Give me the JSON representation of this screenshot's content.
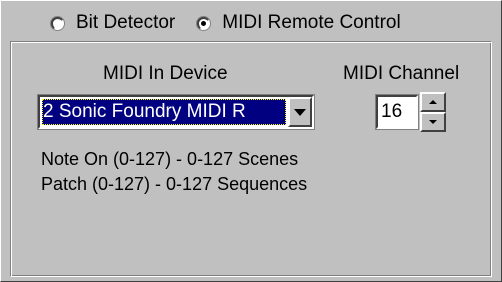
{
  "mode": {
    "options": [
      {
        "label": "Bit Detector",
        "checked": false
      },
      {
        "label": "MIDI Remote Control",
        "checked": true
      }
    ]
  },
  "midi_in": {
    "label": "MIDI In Device",
    "selected": "2 Sonic Foundry MIDI R"
  },
  "midi_channel": {
    "label": "MIDI Channel",
    "value": "16"
  },
  "info": {
    "line1": "Note On (0-127) - 0-127 Scenes",
    "line2": "Patch (0-127) - 0-127 Sequences"
  },
  "icons": {
    "combo_arrow": "chevron-down-icon",
    "spin_up": "arrow-up-icon",
    "spin_down": "arrow-down-icon"
  }
}
